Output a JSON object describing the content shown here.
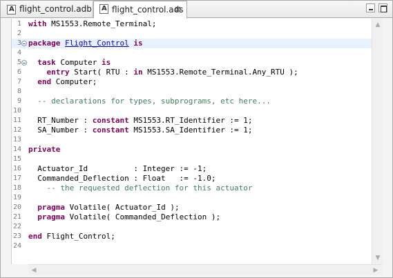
{
  "tabs": [
    {
      "label": "flight_control.adb",
      "icon": "ada-file-icon",
      "active": false
    },
    {
      "label": "flight_control.ads",
      "icon": "ada-file-icon",
      "active": true,
      "close_glyph": "⊠"
    }
  ],
  "window_controls": {
    "minimize": "minimize-icon",
    "maximize": "maximize-icon"
  },
  "editor": {
    "colors": {
      "keyword": "#7f0055",
      "comment": "#3f7f5f",
      "link": "#0000cc",
      "current_line": "#e8f2fe"
    },
    "current_line": 3,
    "lines": [
      {
        "n": "1",
        "tokens": [
          [
            "kw",
            "with"
          ],
          [
            "t",
            " MS1553.Remote_Terminal;"
          ]
        ]
      },
      {
        "n": "2",
        "tokens": []
      },
      {
        "n": "3",
        "fold": true,
        "tokens": [
          [
            "kw",
            "package"
          ],
          [
            "t",
            " "
          ],
          [
            "lnk",
            "Flight_Control"
          ],
          [
            "t",
            " "
          ],
          [
            "kw",
            "is"
          ]
        ]
      },
      {
        "n": "4",
        "tokens": []
      },
      {
        "n": "5",
        "fold": true,
        "tokens": [
          [
            "t",
            "  "
          ],
          [
            "kw",
            "task"
          ],
          [
            "t",
            " Computer "
          ],
          [
            "kw",
            "is"
          ]
        ]
      },
      {
        "n": "6",
        "tokens": [
          [
            "t",
            "    "
          ],
          [
            "kw",
            "entry"
          ],
          [
            "t",
            " Start( RTU : "
          ],
          [
            "kw",
            "in"
          ],
          [
            "t",
            " MS1553.Remote_Terminal.Any_RTU );"
          ]
        ]
      },
      {
        "n": "7",
        "tokens": [
          [
            "t",
            "  "
          ],
          [
            "kw",
            "end"
          ],
          [
            "t",
            " Computer;"
          ]
        ]
      },
      {
        "n": "8",
        "tokens": []
      },
      {
        "n": "9",
        "tokens": [
          [
            "cm",
            "  -- declarations for types, subprograms, etc here..."
          ]
        ]
      },
      {
        "n": "10",
        "tokens": []
      },
      {
        "n": "11",
        "tokens": [
          [
            "t",
            "  RT_Number : "
          ],
          [
            "kw",
            "constant"
          ],
          [
            "t",
            " MS1553.RT_Identifier := 1;"
          ]
        ]
      },
      {
        "n": "12",
        "tokens": [
          [
            "t",
            "  SA_Number : "
          ],
          [
            "kw",
            "constant"
          ],
          [
            "t",
            " MS1553.SA_Identifier := 1;"
          ]
        ]
      },
      {
        "n": "13",
        "tokens": []
      },
      {
        "n": "14",
        "tokens": [
          [
            "kw",
            "private"
          ]
        ]
      },
      {
        "n": "15",
        "tokens": []
      },
      {
        "n": "16",
        "tokens": [
          [
            "t",
            "  Actuator_Id          : Integer := -1;"
          ]
        ]
      },
      {
        "n": "17",
        "tokens": [
          [
            "t",
            "  Commanded_Deflection : Float   := -1.0;"
          ]
        ]
      },
      {
        "n": "18",
        "tokens": [
          [
            "cm",
            "    -- the requested deflection for this actuator"
          ]
        ]
      },
      {
        "n": "19",
        "tokens": []
      },
      {
        "n": "20",
        "tokens": [
          [
            "t",
            "  "
          ],
          [
            "kw",
            "pragma"
          ],
          [
            "t",
            " Volatile( Actuator_Id );"
          ]
        ]
      },
      {
        "n": "21",
        "tokens": [
          [
            "t",
            "  "
          ],
          [
            "kw",
            "pragma"
          ],
          [
            "t",
            " Volatile( Commanded_Deflection );"
          ]
        ]
      },
      {
        "n": "22",
        "tokens": []
      },
      {
        "n": "23",
        "tokens": [
          [
            "kw",
            "end"
          ],
          [
            "t",
            " Flight_Control;"
          ]
        ]
      },
      {
        "n": "24",
        "tokens": []
      }
    ]
  },
  "scrollbars": {
    "up_glyph": "▲",
    "down_glyph": "▼",
    "left_glyph": "◀",
    "right_glyph": "▶"
  }
}
